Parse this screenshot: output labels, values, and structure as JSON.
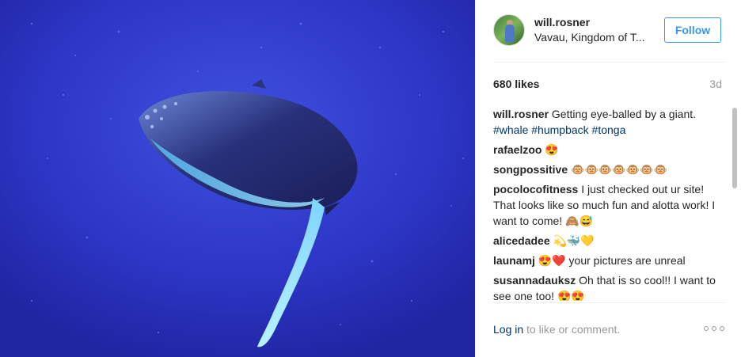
{
  "post": {
    "username": "will.rosner",
    "location": "Vavau, Kingdom of T...",
    "follow_label": "Follow",
    "likes": "680 likes",
    "time": "3d"
  },
  "caption": {
    "user": "will.rosner",
    "text": "Getting eye-balled by a giant.",
    "tags": [
      "#whale",
      "#humpback",
      "#tonga"
    ]
  },
  "comments": [
    {
      "user": "rafaelzoo",
      "text": "😍"
    },
    {
      "user": "songpossitive",
      "text": "🐵🐵🐵🐵🐵🐵🐵"
    },
    {
      "user": "pocolocofitness",
      "text": "I just checked out ur site! That looks like so much fun and alotta work! I want to come! 🙈😅"
    },
    {
      "user": "alicedadee",
      "text": "💫🐳💛"
    },
    {
      "user": "launamj",
      "text": "😍❤️ your pictures are unreal"
    },
    {
      "user": "susannadauksz",
      "text": "Oh that is so cool!! I want to see one too! 😍😍"
    }
  ],
  "footer": {
    "login_label": "Log in",
    "login_suffix": " to like or comment."
  },
  "colors": {
    "link": "#3897f0",
    "hashtag": "#003569",
    "muted": "#999999",
    "ocean": "#2d35c4"
  },
  "icons": {
    "more": "more-horizontal-icon"
  }
}
